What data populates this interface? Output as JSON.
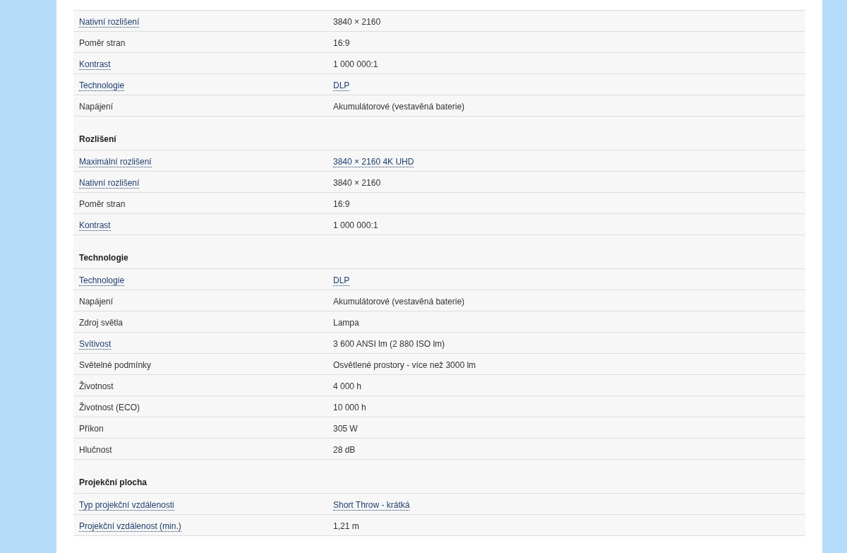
{
  "sections": [
    {
      "rows": [
        {
          "label": "Nativní rozlišení",
          "label_link": true,
          "value": "3840 × 2160",
          "value_link": false
        },
        {
          "label": "Poměr stran",
          "label_link": false,
          "value": "16:9",
          "value_link": false
        },
        {
          "label": "Kontrast",
          "label_link": true,
          "value": "1 000 000:1",
          "value_link": false
        },
        {
          "label": "Technologie",
          "label_link": true,
          "value": "DLP",
          "value_link": true
        },
        {
          "label": "Napájení",
          "label_link": false,
          "value": "Akumulátorové (vestavěná baterie)",
          "value_link": false
        }
      ]
    },
    {
      "title": "Rozlišení",
      "rows": [
        {
          "label": "Maximální rozlišení",
          "label_link": true,
          "value": "3840 × 2160 4K UHD",
          "value_link": true
        },
        {
          "label": "Nativní rozlišení",
          "label_link": true,
          "value": "3840 × 2160",
          "value_link": false
        },
        {
          "label": "Poměr stran",
          "label_link": false,
          "value": "16:9",
          "value_link": false
        },
        {
          "label": "Kontrast",
          "label_link": true,
          "value": "1 000 000:1",
          "value_link": false
        }
      ]
    },
    {
      "title": "Technologie",
      "rows": [
        {
          "label": "Technologie",
          "label_link": true,
          "value": "DLP",
          "value_link": true
        },
        {
          "label": "Napájení",
          "label_link": false,
          "value": "Akumulátorové (vestavěná baterie)",
          "value_link": false
        },
        {
          "label": "Zdroj světla",
          "label_link": false,
          "value": "Lampa",
          "value_link": false
        },
        {
          "label": "Svítivost",
          "label_link": true,
          "value": "3 600 ANSI lm (2 880 ISO lm)",
          "value_link": false
        },
        {
          "label": "Světelné podmínky",
          "label_link": false,
          "value": "Osvětlené prostory - více než 3000 lm",
          "value_link": false
        },
        {
          "label": "Životnost",
          "label_link": false,
          "value": "4 000 h",
          "value_link": false
        },
        {
          "label": "Životnost (ECO)",
          "label_link": false,
          "value": "10 000 h",
          "value_link": false
        },
        {
          "label": "Příkon",
          "label_link": false,
          "value": "305 W",
          "value_link": false
        },
        {
          "label": "Hlučnost",
          "label_link": false,
          "value": "28 dB",
          "value_link": false
        }
      ]
    },
    {
      "title": "Projekční plocha",
      "rows": [
        {
          "label": "Typ projekční vzdálenosti",
          "label_link": true,
          "value": "Short Throw - krátká",
          "value_link": true
        },
        {
          "label": "Projekční vzdálenost (min.)",
          "label_link": true,
          "value": "1,21 m",
          "value_link": false
        }
      ]
    }
  ]
}
